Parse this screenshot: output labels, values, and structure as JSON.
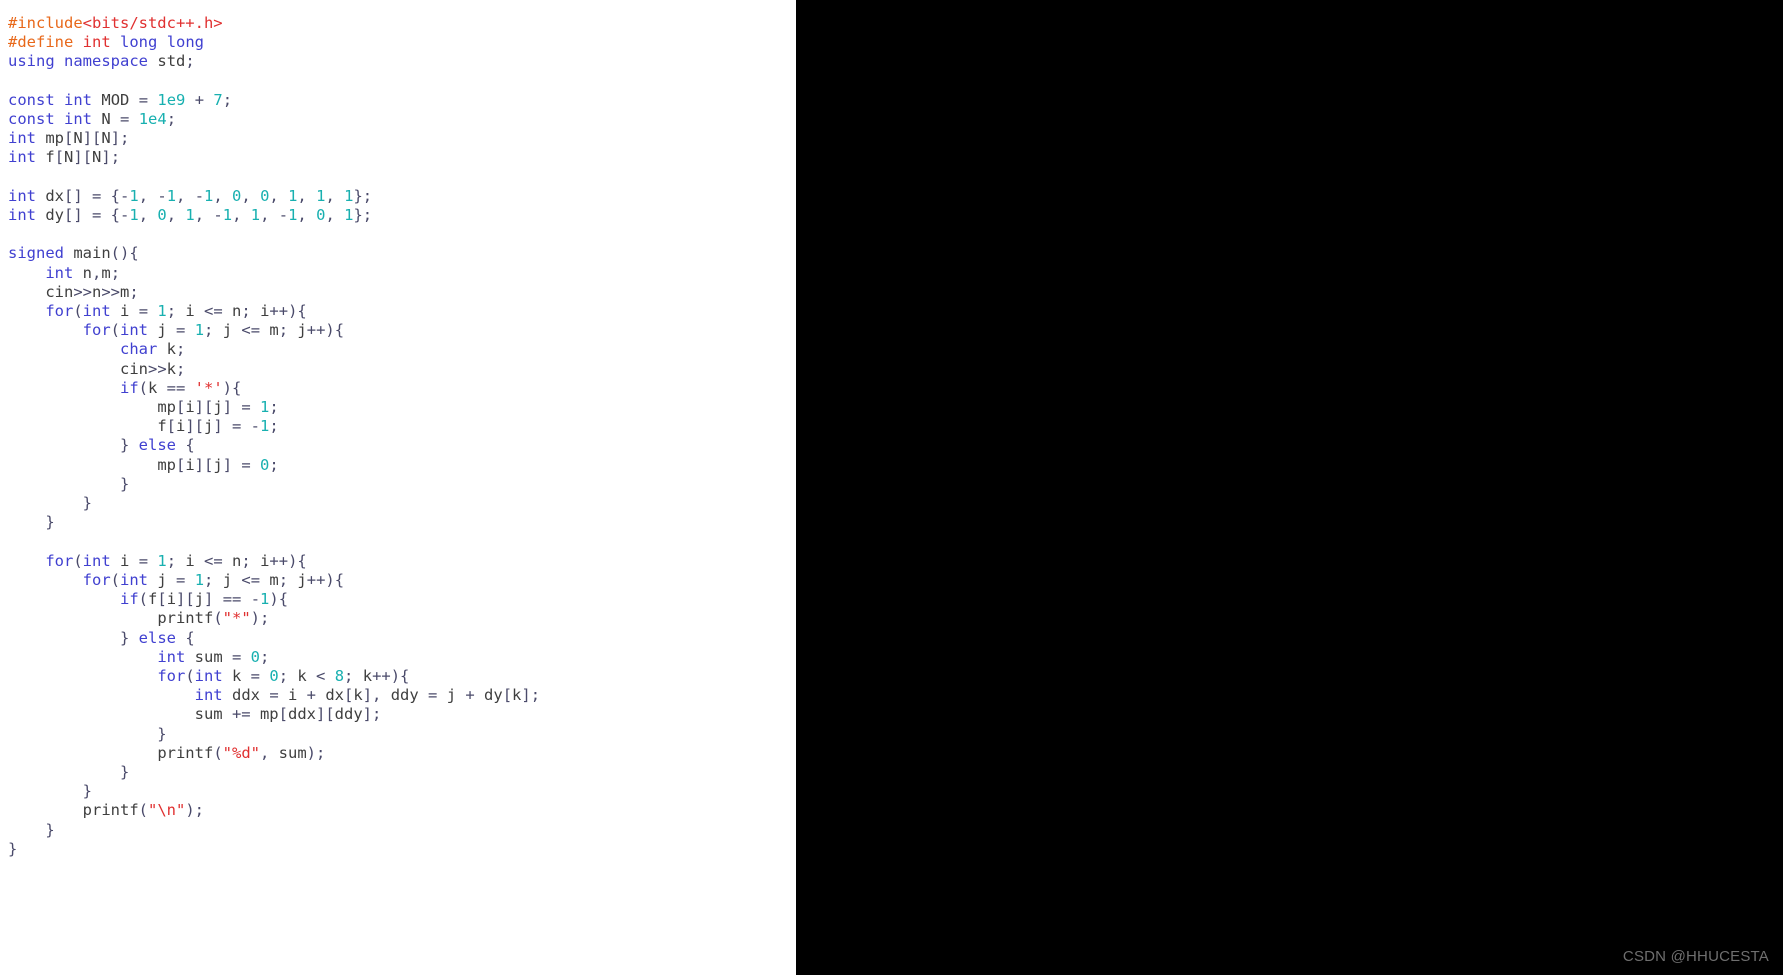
{
  "window": {
    "background_color": "#ffffff",
    "panel_color": "#000000"
  },
  "watermark": {
    "text": "CSDN @HHUCESTA",
    "color": "#6f6f6f"
  },
  "editor": {
    "language": "cpp",
    "font_family": "monospace",
    "colors": {
      "preprocessor": "#e8681a",
      "header": "#e03030",
      "keyword": "#4040d0",
      "number": "#18b0b0",
      "string": "#e03030",
      "plain": "#3f3f3f",
      "background": "#ffffff"
    },
    "lines": [
      "#include<bits/stdc++.h>",
      "#define int long long",
      "using namespace std;",
      "",
      "const int MOD = 1e9 + 7;",
      "const int N = 1e4;",
      "int mp[N][N];",
      "int f[N][N];",
      "",
      "int dx[] = {-1, -1, -1, 0, 0, 1, 1, 1};",
      "int dy[] = {-1, 0, 1, -1, 1, -1, 0, 1};",
      "",
      "signed main(){",
      "    int n,m;",
      "    cin>>n>>m;",
      "    for(int i = 1; i <= n; i++){",
      "        for(int j = 1; j <= m; j++){",
      "            char k;",
      "            cin>>k;",
      "            if(k == '*'){",
      "                mp[i][j] = 1;",
      "                f[i][j] = -1;",
      "            } else {",
      "                mp[i][j] = 0;",
      "            }",
      "        }",
      "    }",
      "",
      "    for(int i = 1; i <= n; i++){",
      "        for(int j = 1; j <= m; j++){",
      "            if(f[i][j] == -1){",
      "                printf(\"*\");",
      "            } else {",
      "                int sum = 0;",
      "                for(int k = 0; k < 8; k++){",
      "                    int ddx = i + dx[k], ddy = j + dy[k];",
      "                    sum += mp[ddx][ddy];",
      "                }",
      "                printf(\"%d\", sum);",
      "            }",
      "        }",
      "        printf(\"\\n\");",
      "    }",
      "}"
    ]
  }
}
